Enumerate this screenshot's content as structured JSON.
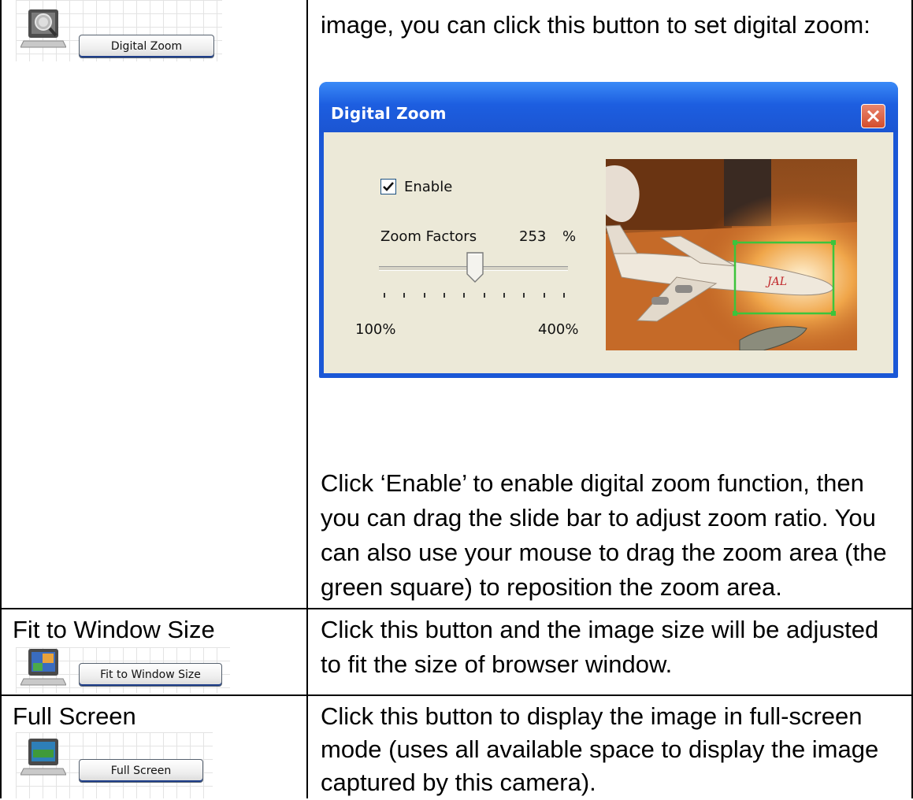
{
  "rows": [
    {
      "button_label": "Digital Zoom",
      "icon": "magnifier-laptop-icon",
      "description_intro": "image, you can click this button to set digital zoom:",
      "description_lines": [
        "Click ‘Enable’ to enable digital zoom function, then",
        "you can drag the slide bar to adjust zoom ratio. You",
        "can also use your mouse to drag the zoom area (the",
        "green square) to reposition the zoom area."
      ]
    },
    {
      "label": "Fit to Window Size",
      "button_label": "Fit to Window Size",
      "icon": "fit-window-laptop-icon",
      "description_lines": [
        "Click this button and the image size will be adjusted",
        "to fit the size of browser window."
      ]
    },
    {
      "label": "Full Screen",
      "button_label": "Full Screen",
      "icon": "full-screen-laptop-icon",
      "description_lines": [
        "Click this button to display the image in full-screen",
        "mode (uses all available space to display the image",
        "captured by this camera)."
      ]
    }
  ],
  "dialog": {
    "title": "Digital Zoom",
    "enable_label": "Enable",
    "enable_checked": true,
    "zoom_factor_label": "Zoom Factors",
    "zoom_factor_value": "253",
    "zoom_factor_unit": "%",
    "slider_min_label": "100%",
    "slider_max_label": "400%",
    "slider_value": 253,
    "slider_min": 100,
    "slider_max": 400,
    "preview_airline_text": "JAL",
    "colors": {
      "titlebar": "#1d5ee0",
      "body": "#ece9d8",
      "zoom_box": "#3cc43c",
      "close": "#d44d2d"
    }
  }
}
